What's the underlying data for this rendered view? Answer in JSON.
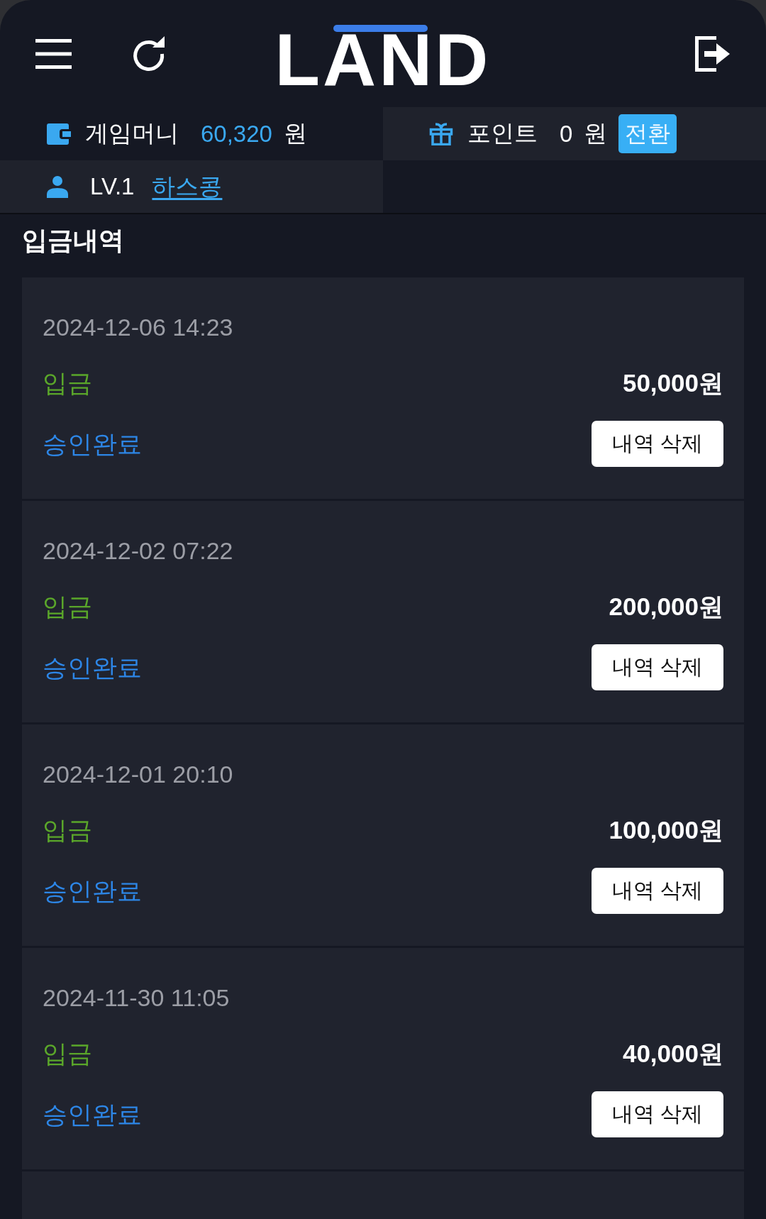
{
  "header": {
    "logo": "LAND"
  },
  "balance": {
    "money_label": "게임머니",
    "money_value": "60,320",
    "money_unit": "원",
    "points_label": "포인트",
    "points_value": "0",
    "points_unit": "원",
    "convert_button": "전환"
  },
  "user": {
    "level": "LV.1",
    "nickname": "하스콩"
  },
  "page_title": "입금내역",
  "records": [
    {
      "date": "2024-12-06 14:23",
      "type": "입금",
      "amount": "50,000원",
      "status": "승인완료",
      "delete_button": "내역 삭제"
    },
    {
      "date": "2024-12-02 07:22",
      "type": "입금",
      "amount": "200,000원",
      "status": "승인완료",
      "delete_button": "내역 삭제"
    },
    {
      "date": "2024-12-01 20:10",
      "type": "입금",
      "amount": "100,000원",
      "status": "승인완료",
      "delete_button": "내역 삭제"
    },
    {
      "date": "2024-11-30 11:05",
      "type": "입금",
      "amount": "40,000원",
      "status": "승인완료",
      "delete_button": "내역 삭제"
    }
  ]
}
